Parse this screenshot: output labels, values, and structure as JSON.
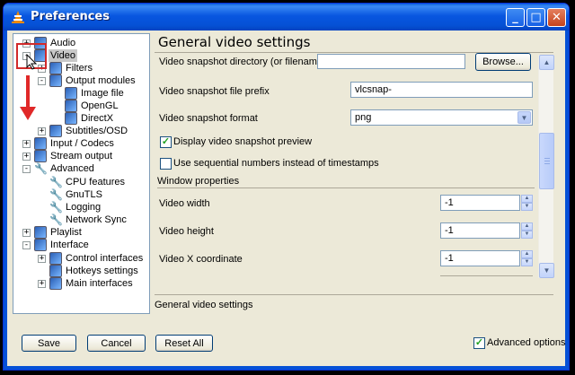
{
  "window": {
    "title": "Preferences"
  },
  "colors": {
    "titlebar": "#0551d6",
    "selection": "#c8c8c8",
    "annotation": "#e02828"
  },
  "tree": {
    "items": [
      {
        "label": "Audio",
        "icon": "audio-icon",
        "expander": "+"
      },
      {
        "label": "Video",
        "icon": "video-icon",
        "expander": "-",
        "selected": true
      },
      {
        "label": "Filters",
        "icon": "filters-icon",
        "expander": "+"
      },
      {
        "label": "Output modules",
        "icon": "output-modules-icon",
        "expander": "-"
      },
      {
        "label": "Image file",
        "icon": "image-file-icon"
      },
      {
        "label": "OpenGL",
        "icon": "opengl-icon"
      },
      {
        "label": "DirectX",
        "icon": "directx-icon"
      },
      {
        "label": "Subtitles/OSD",
        "icon": "subtitles-icon",
        "expander": "+"
      },
      {
        "label": "Input / Codecs",
        "icon": "input-codecs-icon",
        "expander": "+"
      },
      {
        "label": "Stream output",
        "icon": "stream-output-icon",
        "expander": "+"
      },
      {
        "label": "Advanced",
        "icon": "advanced-wrench-icon",
        "expander": "-"
      },
      {
        "label": "CPU features",
        "icon": "wrench-icon"
      },
      {
        "label": "GnuTLS",
        "icon": "wrench-icon"
      },
      {
        "label": "Logging",
        "icon": "wrench-icon"
      },
      {
        "label": "Network Sync",
        "icon": "wrench-icon"
      },
      {
        "label": "Playlist",
        "icon": "playlist-icon",
        "expander": "+"
      },
      {
        "label": "Interface",
        "icon": "interface-icon",
        "expander": "-"
      },
      {
        "label": "Control interfaces",
        "icon": "control-interfaces-icon",
        "expander": "+"
      },
      {
        "label": "Hotkeys settings",
        "icon": "hotkeys-icon"
      },
      {
        "label": "Main interfaces",
        "icon": "main-interfaces-icon",
        "expander": "+"
      }
    ]
  },
  "panel": {
    "title": "General video settings",
    "snapshot_dir_label": "Video snapshot directory (or filename)",
    "snapshot_dir_value": "",
    "browse_label": "Browse...",
    "prefix_label": "Video snapshot file prefix",
    "prefix_value": "vlcsnap-",
    "format_label": "Video snapshot format",
    "format_value": "png",
    "preview_label": "Display video snapshot preview",
    "preview_checked": true,
    "sequential_label": "Use sequential numbers instead of timestamps",
    "sequential_checked": false,
    "window_section": "Window properties",
    "width_label": "Video width",
    "width_value": "-1",
    "height_label": "Video height",
    "height_value": "-1",
    "xcoord_label": "Video X coordinate",
    "xcoord_value": "-1",
    "footer": "General video settings"
  },
  "buttons": {
    "save": "Save",
    "cancel": "Cancel",
    "reset": "Reset All"
  },
  "advanced_options": {
    "label": "Advanced options",
    "checked": true
  }
}
